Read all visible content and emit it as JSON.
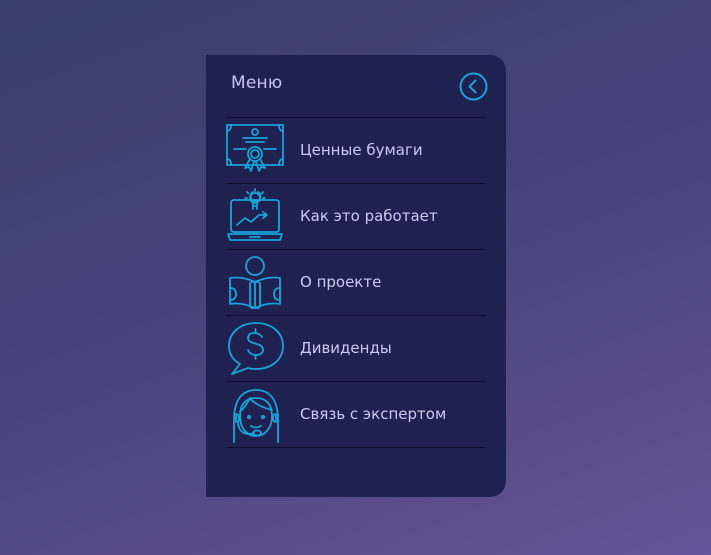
{
  "menu": {
    "title": "Меню",
    "items": [
      {
        "label": "Ценные бумаги",
        "icon": "certificate-icon"
      },
      {
        "label": "Как это работает",
        "icon": "laptop-growth-icon"
      },
      {
        "label": "О проекте",
        "icon": "reader-icon"
      },
      {
        "label": "Дивиденды",
        "icon": "dollar-chat-icon"
      },
      {
        "label": "Связь с экспертом",
        "icon": "support-agent-icon"
      }
    ]
  },
  "colors": {
    "panel": "#1f2150",
    "accent": "#1aa3d6",
    "text": "#c9cbf0"
  }
}
